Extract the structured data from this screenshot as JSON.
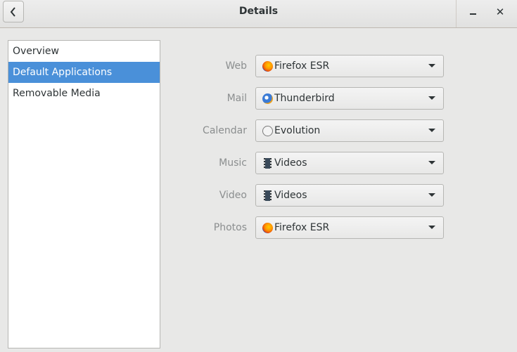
{
  "header": {
    "title": "Details",
    "back_icon": "chevron-left-icon",
    "minimize_icon": "minimize-icon",
    "close_label": "✕"
  },
  "sidebar": {
    "items": [
      {
        "label": "Overview",
        "active": false
      },
      {
        "label": "Default Applications",
        "active": true
      },
      {
        "label": "Removable Media",
        "active": false
      }
    ]
  },
  "defaults": {
    "rows": [
      {
        "label": "Web",
        "value": "Firefox ESR",
        "icon": "firefox-icon"
      },
      {
        "label": "Mail",
        "value": "Thunderbird",
        "icon": "thunderbird-icon"
      },
      {
        "label": "Calendar",
        "value": "Evolution",
        "icon": "evolution-icon"
      },
      {
        "label": "Music",
        "value": "Videos",
        "icon": "videos-icon"
      },
      {
        "label": "Video",
        "value": "Videos",
        "icon": "videos-icon"
      },
      {
        "label": "Photos",
        "value": "Firefox ESR",
        "icon": "firefox-icon"
      }
    ]
  },
  "colors": {
    "accent": "#4a90d9",
    "background": "#e8e8e7"
  }
}
